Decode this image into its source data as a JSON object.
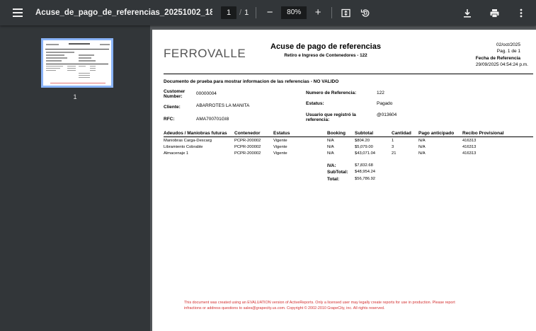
{
  "toolbar": {
    "title": "Acuse_de_pago_de_referencias_20251002_185132_...",
    "page_current": "1",
    "page_sep": "/",
    "page_total": "1",
    "zoom_out": "−",
    "zoom": "80%",
    "zoom_in": "+"
  },
  "sidebar": {
    "thumb_number": "1"
  },
  "doc": {
    "logo": "FERROVALLE",
    "title": "Acuse de pago de referencias",
    "subtitle": "Retiro e Ingreso de Contenedores - 122",
    "date": "02/oct/2025",
    "page_label": "Pag. 1 de 1",
    "ref_date_label": "Fecha de Referencia",
    "ref_date_value": "29/09/2025 04:54:24 p.m.",
    "note": "Documento de prueba para mostrar informacion de las referencias - NO VALIDO",
    "customer_label_1": "Customer",
    "customer_label_2": "Number:",
    "customer_value": "00000004",
    "cliente_label": "Cliente:",
    "cliente_value": "ABARROTES LA MANITA",
    "rfc_label": "RFC:",
    "rfc_value": "AMA700701GI8",
    "numref_label": "Numero de Referencia:",
    "numref_value": "122",
    "estatus_label": "Estatus:",
    "estatus_value": "Pagado",
    "usuario_label_1": "Usuario que registró la",
    "usuario_label_2": "referencia:",
    "usuario_value": "@013604",
    "columns": {
      "adeudos": "Adeudos / Maniobras futuras",
      "contenedor": "Contenedor",
      "estatus": "Estatus",
      "booking": "Booking",
      "subtotal": "Subtotal",
      "cantidad": "Cantidad",
      "pago": "Pago anticipado",
      "recibo": "Recibo Provisional"
    },
    "rows": [
      {
        "adeudo": "Maniobras Carga-Descarg",
        "contenedor": "PCPR-200002",
        "estatus": "Vigente",
        "booking": "N/A",
        "subtotal": "$804.20",
        "cantidad": "1",
        "pago": "N/A",
        "recibo": "416313"
      },
      {
        "adeudo": "Libramiento Cobrable",
        "contenedor": "PCPR-200002",
        "estatus": "Vigente",
        "booking": "N/A",
        "subtotal": "$5,079.00",
        "cantidad": "3",
        "pago": "N/A",
        "recibo": "416313"
      },
      {
        "adeudo": "Almacenaje 1",
        "contenedor": "PCPR-200002",
        "estatus": "Vigente",
        "booking": "N/A",
        "subtotal": "$43,071.04",
        "cantidad": "21",
        "pago": "N/A",
        "recibo": "416313"
      }
    ],
    "totals": {
      "iva_label": "IVA:",
      "iva_value": "$7,832.68",
      "subtotal_label": "SubTotal:",
      "subtotal_value": "$48,954.24",
      "total_label": "Total:",
      "total_value": "$56,786.92"
    },
    "eval_line1": "This document was created using an EVALUATION version of ActiveReports. Only a licensed user may legally create reports for use in production. Please report",
    "eval_line2": "infractions or address questions to sales@grapecity.us.com.  Copyright © 2002-2010 GrapeCity, inc. All rights reserved."
  },
  "colors": {
    "toolbar": "#323639",
    "viewer_bg": "#525659",
    "thumb_border": "#8ab4f8",
    "eval_text": "#d32f2f"
  }
}
